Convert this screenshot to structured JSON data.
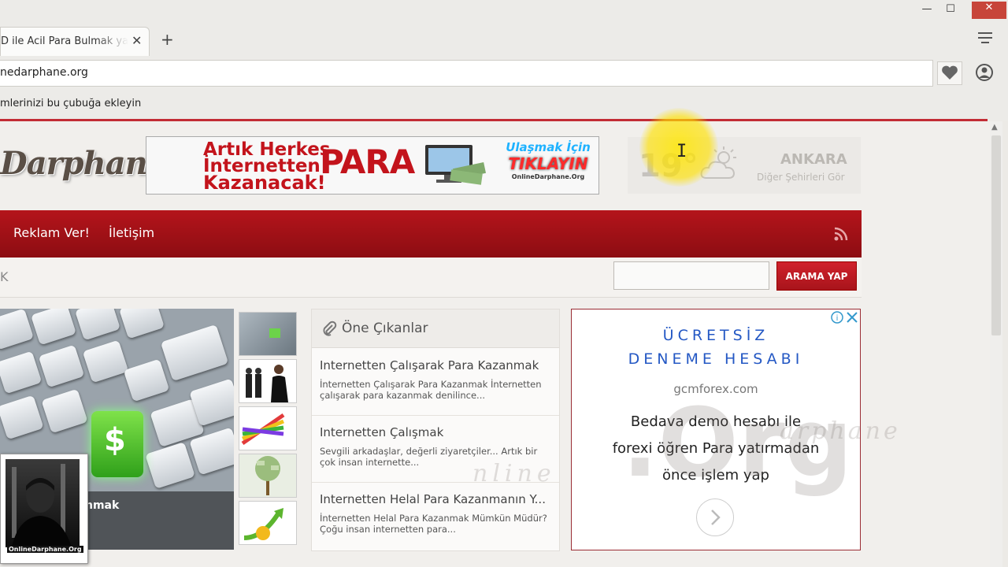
{
  "browser": {
    "tab_title": "D ile Acil Para Bulmak ya",
    "url": "nedarphane.org",
    "bookmarks_hint": "mlerinizi bu çubuğa ekleyin",
    "window_buttons": {
      "minimize": "—",
      "maximize": "☐",
      "close": "✕"
    },
    "new_tab": "+",
    "tab_close": "✕"
  },
  "site": {
    "logo_text": "Darphane",
    "banner": {
      "line1": "Artık Herkes",
      "line2": "İnternetten",
      "line3": "Kazanacak!",
      "big_word": "PARA",
      "cta_top": "Ulaşmak İçin",
      "cta_main": "TIKLAYIN",
      "cta_site": "OnlineDarphane.Org"
    },
    "weather": {
      "temperature": "19°",
      "city": "ANKARA",
      "other_cities_link": "Diğer Şehirleri Gör",
      "icon": "cloud-sun-icon"
    },
    "nav": {
      "items": [
        {
          "label": "Reklam Ver!"
        },
        {
          "label": "İletişim"
        }
      ],
      "rss_icon": "rss-icon"
    },
    "search": {
      "left_text": "K",
      "input_value": "",
      "button_label": "ARAMA YAP"
    },
    "slider": {
      "caption": "nmak",
      "avatar_label": "OnlineDarphane.Org"
    },
    "featured": {
      "title": "Öne Çıkanlar",
      "items": [
        {
          "title": "Internetten Çalışarak Para Kazanmak",
          "desc": "İnternetten Çalışarak Para Kazanmak İnternetten çalışarak para kazanmak denilince..."
        },
        {
          "title": "Internetten Çalışmak",
          "desc": "Sevgili arkadaşlar, değerli ziyaretçiler... Artık bir çok insan internette..."
        },
        {
          "title": "Internetten Helal Para Kazanmanın Y...",
          "desc": "İnternetten Helal Para Kazanmak Mümkün Müdür? Çoğu insan internetten para..."
        }
      ]
    },
    "ad": {
      "heading1": "ÜCRETSİZ",
      "heading2": "DENEME HESABI",
      "domain": "gcmforex.com",
      "body_line1": "Bedava demo hesabı ile",
      "body_line2": "forexi öğren Para yatırmadan",
      "body_line3": "önce işlem yap"
    }
  },
  "colors": {
    "brand_red": "#b4141b",
    "ad_blue": "#2458c4",
    "cursor_highlight": "#ffe600"
  }
}
